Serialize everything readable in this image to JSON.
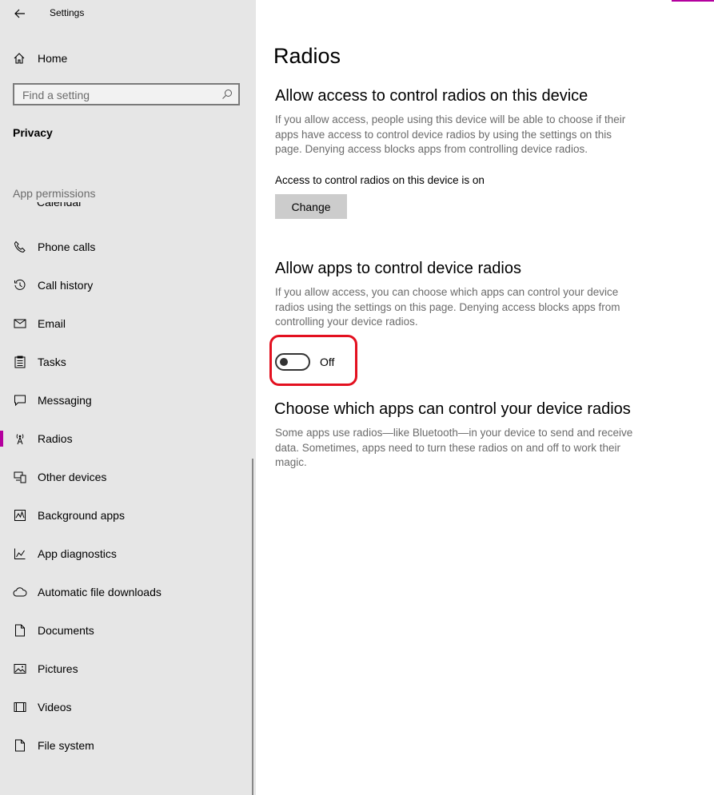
{
  "window": {
    "title": "Settings"
  },
  "sidebar": {
    "home_label": "Home",
    "search_placeholder": "Find a setting",
    "category": "Privacy",
    "section_label": "App permissions",
    "cut_item": "Calendar",
    "items": [
      {
        "label": "Phone calls",
        "icon": "phone-icon"
      },
      {
        "label": "Call history",
        "icon": "history-icon"
      },
      {
        "label": "Email",
        "icon": "mail-icon"
      },
      {
        "label": "Tasks",
        "icon": "tasks-icon"
      },
      {
        "label": "Messaging",
        "icon": "message-icon"
      },
      {
        "label": "Radios",
        "icon": "radio-tower-icon",
        "selected": true
      },
      {
        "label": "Other devices",
        "icon": "devices-icon"
      },
      {
        "label": "Background apps",
        "icon": "background-apps-icon"
      },
      {
        "label": "App diagnostics",
        "icon": "diagnostics-icon"
      },
      {
        "label": "Automatic file downloads",
        "icon": "cloud-icon"
      },
      {
        "label": "Documents",
        "icon": "document-icon"
      },
      {
        "label": "Pictures",
        "icon": "picture-icon"
      },
      {
        "label": "Videos",
        "icon": "video-icon"
      },
      {
        "label": "File system",
        "icon": "file-icon"
      }
    ]
  },
  "main": {
    "title": "Radios",
    "section1": {
      "heading": "Allow access to control radios on this device",
      "description": "If you allow access, people using this device will be able to choose if their apps have access to control device radios by using the settings on this page. Denying access blocks apps from controlling device radios.",
      "status": "Access to control radios on this device is on",
      "button": "Change"
    },
    "section2": {
      "heading": "Allow apps to control device radios",
      "description": "If you allow access, you can choose which apps can control your device radios using the settings on this page. Denying access blocks apps from controlling your device radios.",
      "toggle_state": "Off"
    },
    "section3": {
      "heading": "Choose which apps can control your device radios",
      "description": "Some apps use radios—like Bluetooth—in your device to send and receive data. Sometimes, apps need to turn these radios on and off to work their magic."
    }
  },
  "colors": {
    "accent": "#b4009e",
    "highlight": "#e3101f",
    "sidebar_bg": "#e6e6e6"
  }
}
